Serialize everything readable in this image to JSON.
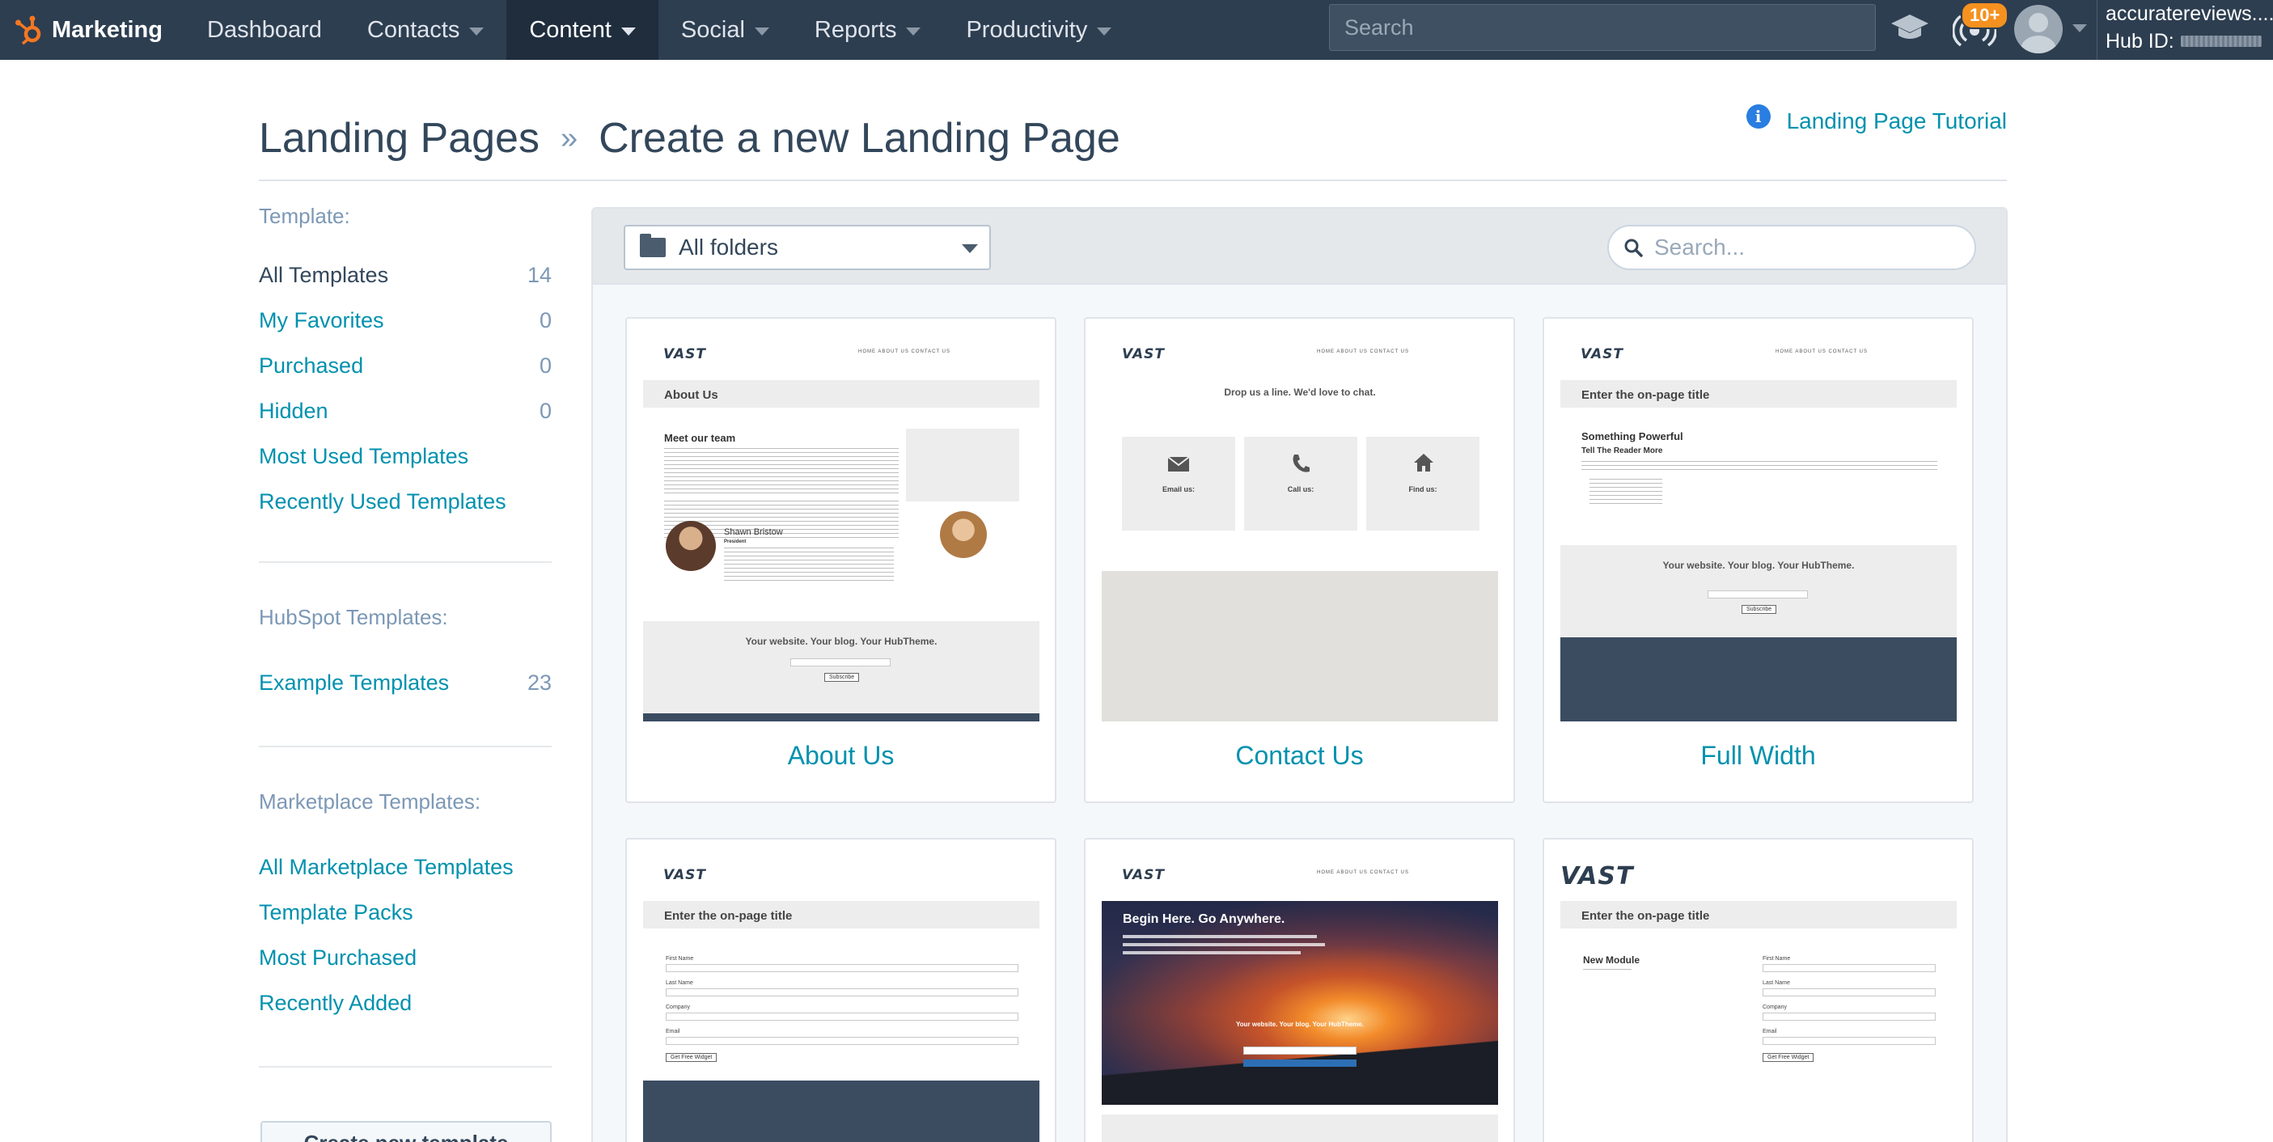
{
  "topnav": {
    "brand": "Marketing",
    "items": [
      {
        "label": "Dashboard",
        "dropdown": false,
        "active": false
      },
      {
        "label": "Contacts",
        "dropdown": true,
        "active": false
      },
      {
        "label": "Content",
        "dropdown": true,
        "active": true
      },
      {
        "label": "Social",
        "dropdown": true,
        "active": false
      },
      {
        "label": "Reports",
        "dropdown": true,
        "active": false
      },
      {
        "label": "Productivity",
        "dropdown": true,
        "active": false
      }
    ],
    "search_placeholder": "Search",
    "notification_badge": "10+",
    "account_name": "accuratereviews....",
    "hub_id_label": "Hub ID:",
    "colors": {
      "nav_bg": "#2d3e50",
      "active_bg": "#1f2d3d",
      "accent": "#f57722",
      "badge": "#f5911f"
    }
  },
  "header": {
    "breadcrumb_root": "Landing Pages",
    "breadcrumb_sep": "»",
    "title": "Create a new Landing Page",
    "tutorial_link": "Landing Page Tutorial"
  },
  "sidebar": {
    "template_heading": "Template:",
    "template_items": [
      {
        "label": "All Templates",
        "count": "14",
        "active": true
      },
      {
        "label": "My Favorites",
        "count": "0"
      },
      {
        "label": "Purchased",
        "count": "0"
      },
      {
        "label": "Hidden",
        "count": "0"
      },
      {
        "label": "Most Used Templates",
        "count": ""
      },
      {
        "label": "Recently Used Templates",
        "count": ""
      }
    ],
    "hubspot_heading": "HubSpot Templates:",
    "hubspot_items": [
      {
        "label": "Example Templates",
        "count": "23"
      }
    ],
    "marketplace_heading": "Marketplace Templates:",
    "marketplace_items": [
      {
        "label": "All Marketplace Templates"
      },
      {
        "label": "Template Packs"
      },
      {
        "label": "Most Purchased"
      },
      {
        "label": "Recently Added"
      }
    ],
    "create_button": "Create new template"
  },
  "panel": {
    "folder_select": "All folders",
    "search_placeholder": "Search..."
  },
  "templates": [
    {
      "title": "About Us"
    },
    {
      "title": "Contact Us"
    },
    {
      "title": "Full Width"
    },
    {
      "title": ""
    },
    {
      "title": ""
    },
    {
      "title": ""
    }
  ],
  "thumbs": {
    "logo": "VAST",
    "nav": "HOME    ABOUT US    CONTACT US",
    "about_band": "About Us",
    "about_meet": "Meet our team",
    "about_name": "Shawn Bristow",
    "about_role": "President",
    "cta": "Your website. Your blog. Your HubTheme.",
    "cta_button": "Subscribe",
    "contact_heading": "Drop us a line. We'd love to chat.",
    "contact_email": "Email us:",
    "contact_call": "Call us:",
    "contact_find": "Find us:",
    "fullwidth_band": "Enter the on-page title",
    "fullwidth_h1": "Something Powerful",
    "fullwidth_h2": "Tell The Reader More",
    "form_band": "Enter the on-page title",
    "form_fields": [
      "First Name",
      "Last Name",
      "Company",
      "Email"
    ],
    "form_button": "Get Free Widget",
    "hero_title": "Begin Here. Go Anywhere.",
    "hero_cta": "Your website. Your blog. Your HubTheme.",
    "module_band": "Enter the on-page title",
    "module_title": "New Module",
    "module_fields": [
      "First Name",
      "Last Name",
      "Company",
      "Email"
    ],
    "module_button": "Get Free Widget"
  }
}
